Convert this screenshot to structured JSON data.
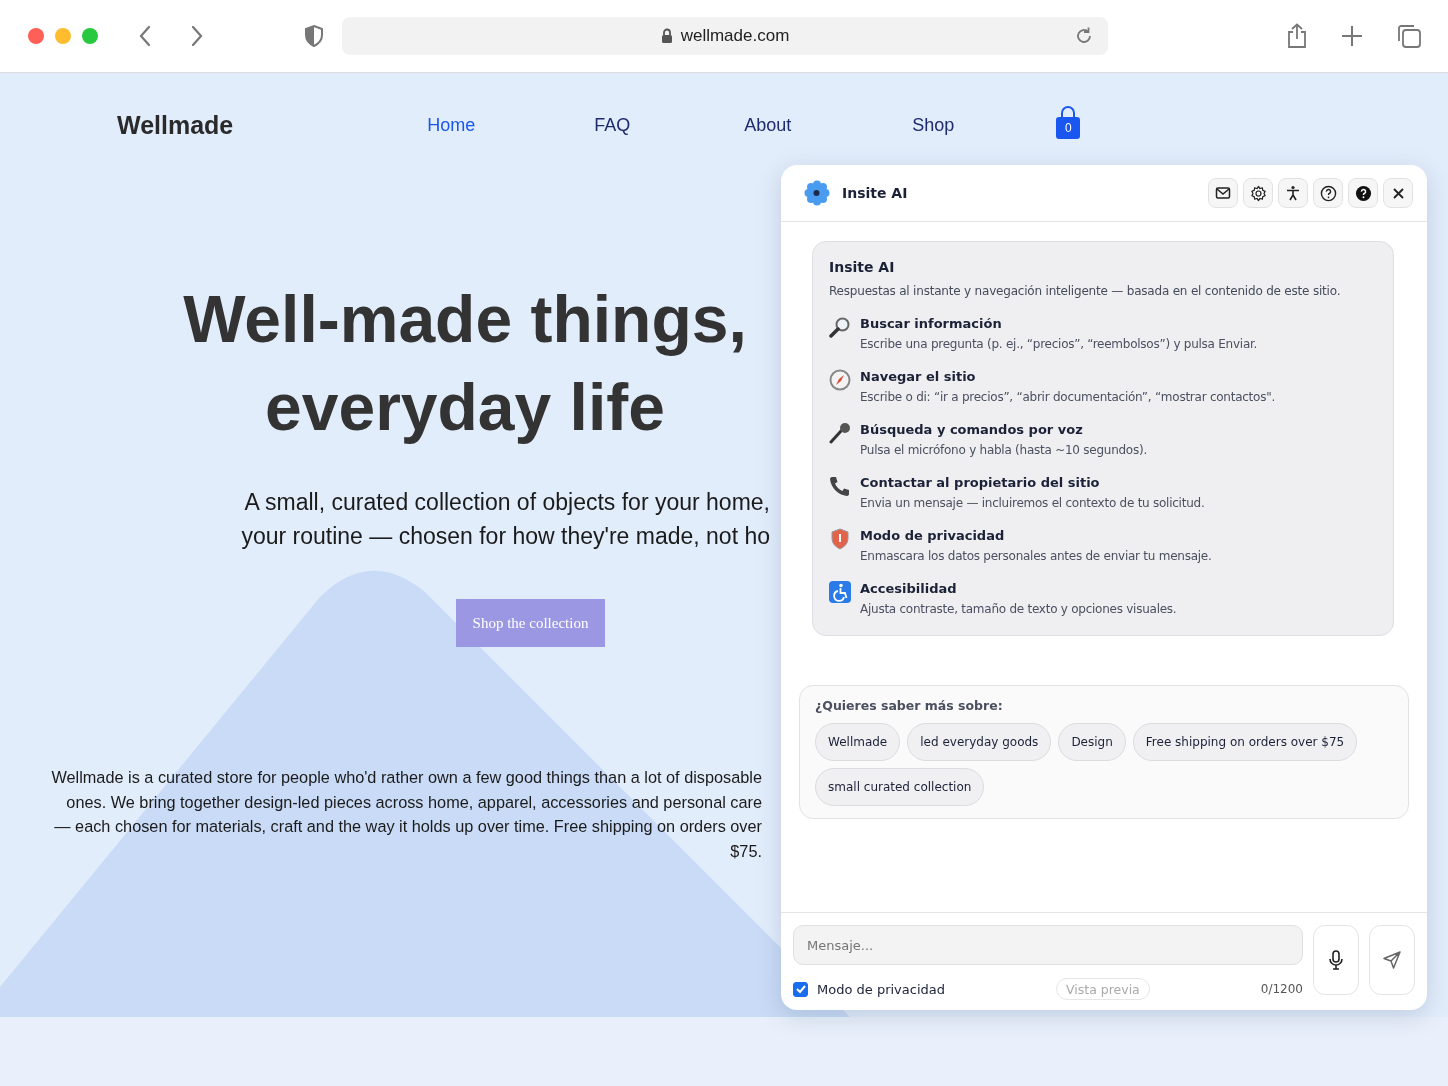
{
  "browser": {
    "url": "wellmade.com"
  },
  "site": {
    "logo": "Wellmade",
    "nav": [
      {
        "label": "Home",
        "selected": true
      },
      {
        "label": "FAQ",
        "selected": false
      },
      {
        "label": "About",
        "selected": false
      },
      {
        "label": "Shop",
        "selected": false
      }
    ],
    "cart_count": "0",
    "hero": {
      "title_lines": [
        "Well-made things,",
        "everyday life"
      ],
      "subtitle_lines": [
        "A small, curated collection of objects for your home,",
        "your routine — chosen for how they're made, not ho"
      ],
      "cta": "Shop the collection"
    },
    "about": "Wellmade is a curated store for people who'd rather own a few good things than a lot of disposable ones. We bring together design-led pieces across home, apparel, accessories and personal care — each chosen for materials, craft and the way it holds up over time. Free shipping on orders over $75."
  },
  "chat": {
    "title": "Insite AI",
    "intro": {
      "title": "Insite AI",
      "subtitle": "Respuestas al instante y navegación inteligente — basada en el contenido de este sitio.",
      "features": [
        {
          "kind": "search",
          "title": "Buscar información",
          "description": "Escribe una pregunta (p. ej., “precios”, “reembolsos”) y pulsa Enviar."
        },
        {
          "kind": "compass",
          "title": "Navegar el sitio",
          "description": "Escribe o di: “ir a precios”, “abrir documentación”, “mostrar contactos\"."
        },
        {
          "kind": "mic",
          "title": "Búsqueda y comandos por voz",
          "description": "Pulsa el micrófono y habla (hasta ~10 segundos)."
        },
        {
          "kind": "phone",
          "title": "Contactar al propietario del sitio",
          "description": "Envia un mensaje — incluiremos el contexto de tu solicitud."
        },
        {
          "kind": "shield",
          "title": "Modo de privacidad",
          "description": "Enmascara los datos personales antes de enviar tu mensaje."
        },
        {
          "kind": "access",
          "title": "Accesibilidad",
          "description": "Ajusta contraste, tamaño de texto y opciones visuales."
        }
      ]
    },
    "suggestions": {
      "heading": "¿Quieres saber más sobre:",
      "chips": [
        "Wellmade",
        "led everyday goods",
        "Design",
        "Free shipping on orders over $75",
        "small curated collection"
      ]
    },
    "composer": {
      "placeholder": "Mensaje...",
      "privacy": {
        "label": "Modo de privacidad",
        "checked": true
      },
      "preview": "Vista previa",
      "counter": "0/1200"
    }
  }
}
